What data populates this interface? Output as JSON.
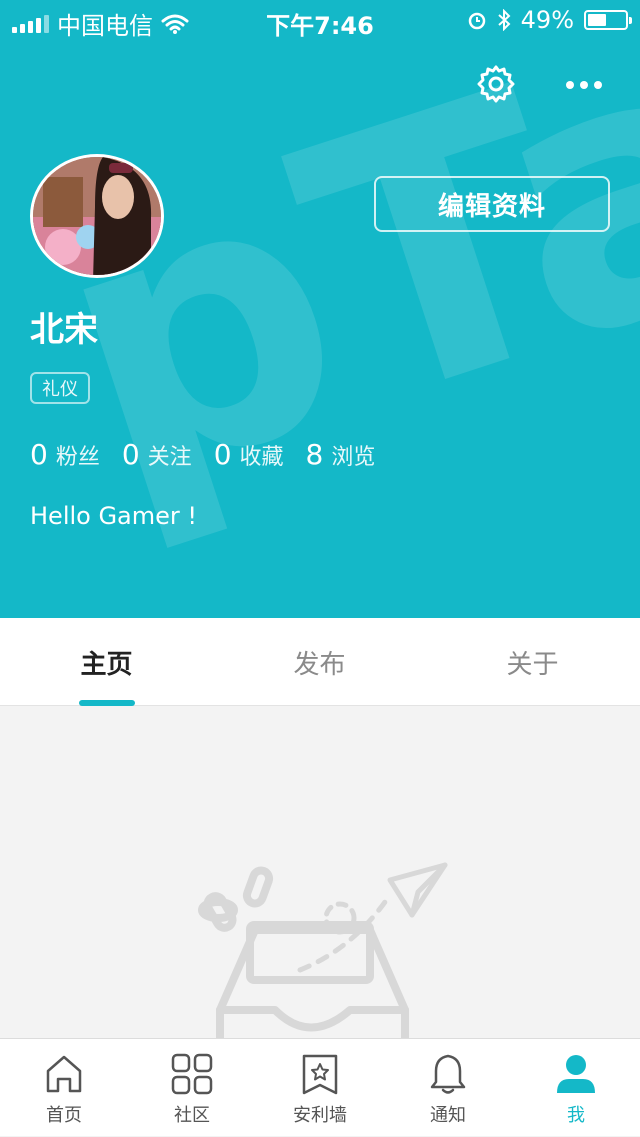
{
  "status_bar": {
    "carrier": "中国电信",
    "time": "下午7:46",
    "battery_percent": "49%",
    "battery_level": 0.49
  },
  "profile": {
    "username": "北宋",
    "tag": "礼仪",
    "edit_label": "编辑资料",
    "bio": "Hello Gamer !",
    "stats": [
      {
        "value": "0",
        "label": "粉丝"
      },
      {
        "value": "0",
        "label": "关注"
      },
      {
        "value": "0",
        "label": "收藏"
      },
      {
        "value": "8",
        "label": "浏览"
      }
    ]
  },
  "tabs": [
    {
      "label": "主页",
      "active": true
    },
    {
      "label": "发布",
      "active": false
    },
    {
      "label": "关于",
      "active": false
    }
  ],
  "bottom_nav": [
    {
      "label": "首页",
      "icon": "home-icon"
    },
    {
      "label": "社区",
      "icon": "grid-icon"
    },
    {
      "label": "安利墙",
      "icon": "bookmark-star-icon"
    },
    {
      "label": "通知",
      "icon": "bell-icon"
    },
    {
      "label": "我",
      "icon": "user-icon",
      "active": true
    }
  ],
  "colors": {
    "brand": "#14b8c8",
    "background": "#f3f3f3"
  }
}
